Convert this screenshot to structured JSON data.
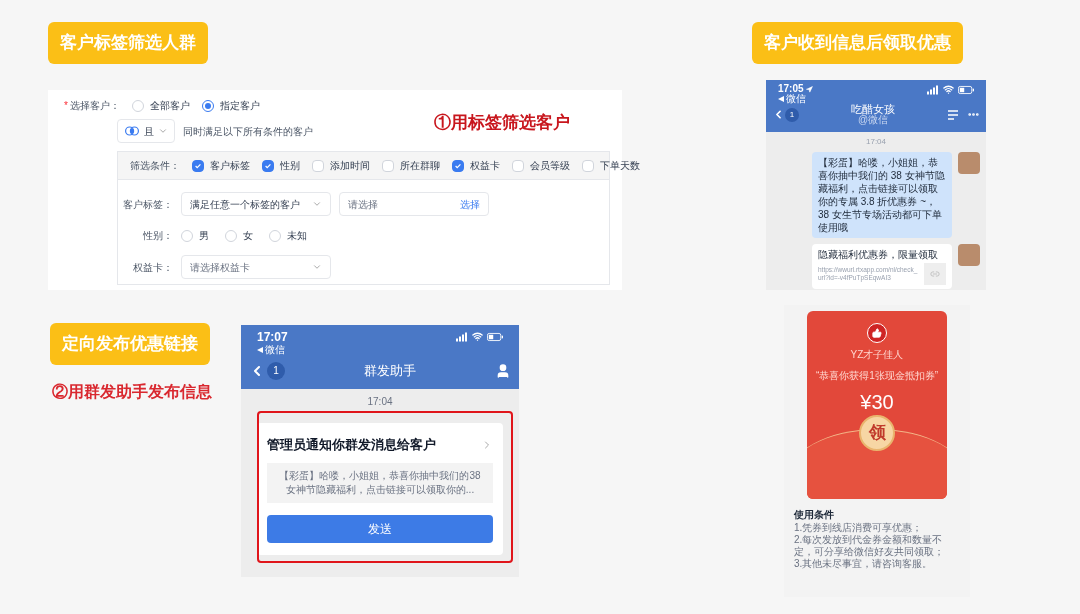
{
  "step1": {
    "badge": "客户标签筛选人群",
    "annotation": "①用标签筛选客户",
    "customer_select": {
      "label": "选择客户：",
      "required_mark": "*",
      "options": [
        {
          "label": "全部客户",
          "selected": false
        },
        {
          "label": "指定客户",
          "selected": true
        }
      ]
    },
    "logic": {
      "value": "且",
      "hint": "同时满足以下所有条件的客户"
    },
    "filters": {
      "label": "筛选条件：",
      "options": [
        {
          "label": "客户标签",
          "checked": true
        },
        {
          "label": "性别",
          "checked": true
        },
        {
          "label": "添加时间",
          "checked": false
        },
        {
          "label": "所在群聊",
          "checked": false
        },
        {
          "label": "权益卡",
          "checked": true
        },
        {
          "label": "会员等级",
          "checked": false
        },
        {
          "label": "下单天数",
          "checked": false
        }
      ]
    },
    "tag_field": {
      "label": "客户标签：",
      "mode": "满足任意一个标签的客户",
      "placeholder": "请选择",
      "action": "选择"
    },
    "gender": {
      "label": "性别：",
      "options": [
        {
          "label": "男",
          "selected": false
        },
        {
          "label": "女",
          "selected": false
        },
        {
          "label": "未知",
          "selected": false
        }
      ]
    },
    "card_field": {
      "label": "权益卡：",
      "placeholder": "请选择权益卡"
    }
  },
  "step2": {
    "badge": "定向发布优惠链接",
    "annotation": "②用群发助手发布信息",
    "phone": {
      "time": "17:07",
      "back_app": "微信",
      "unread": "1",
      "title": "群发助手",
      "timestamp": "17:04",
      "card": {
        "title": "管理员通知你群发消息给客户",
        "preview": "【彩蛋】哈喽，小姐姐，恭喜你抽中我们的38女神节隐藏福利，点击链接可以领取你的...",
        "button": "发送"
      }
    }
  },
  "step3": {
    "badge": "客户收到信息后领取优惠",
    "chat": {
      "time": "17:05",
      "back_app": "微信",
      "unread": "1",
      "title": "吃醋女孩",
      "subtitle": "@微信",
      "timestamp": "17:04",
      "messages": [
        {
          "kind": "text",
          "text": "【彩蛋】哈喽，小姐姐，恭喜你抽中我们的 38 女神节隐藏福利，点击链接可以领取你的专属 3.8 折优惠券 ~，38 女生节专场活动都可下单使用哦"
        },
        {
          "kind": "link",
          "title": "隐藏福利优惠券，限量领取",
          "url": "https://wwurl.rtxapp.com/nl/check_url?id=-v4fPuTpSEqwAI3"
        }
      ]
    },
    "coupon": {
      "sender": "YZ才子佳人",
      "message": "“恭喜你获得1张现金抵扣券”",
      "amount": "¥30",
      "button": "领",
      "terms_title": "使用条件",
      "terms": [
        "1.凭券到线店消费可享优惠；",
        "2.每次发放到代金券金额和数量不定，可分享给微信好友共同领取；",
        "3.其他未尽事宜，请咨询客服。"
      ]
    }
  }
}
